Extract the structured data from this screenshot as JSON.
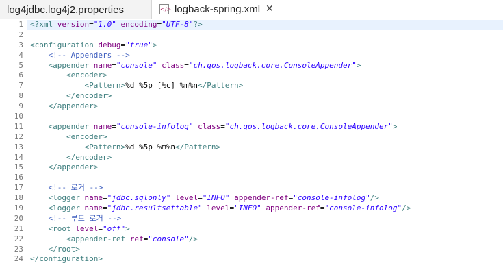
{
  "tabs": [
    {
      "label": "log4jdbc.log4j2.properties",
      "active": false
    },
    {
      "label": "logback-spring.xml",
      "active": true,
      "close": "✕"
    }
  ],
  "colors": {
    "tag": "#3f7f7f",
    "attr": "#7f007f",
    "value": "#2a00ff",
    "comment": "#3f5fbf",
    "text": "#000000",
    "current_line": "#e8f2fe"
  },
  "editor": {
    "lines": [
      {
        "n": "1",
        "tokens": [
          [
            "pi",
            "<?xml "
          ],
          [
            "attr",
            "version"
          ],
          [
            "txt",
            "="
          ],
          [
            "val",
            "\"1.0\""
          ],
          [
            "txt",
            " "
          ],
          [
            "attr",
            "encoding"
          ],
          [
            "txt",
            "="
          ],
          [
            "val",
            "\"UTF-8\""
          ],
          [
            "pi",
            "?>"
          ]
        ]
      },
      {
        "n": "2",
        "tokens": []
      },
      {
        "n": "3",
        "tokens": [
          [
            "tag",
            "<configuration "
          ],
          [
            "attr",
            "debug"
          ],
          [
            "txt",
            "="
          ],
          [
            "val",
            "\"true\""
          ],
          [
            "tag",
            ">"
          ]
        ]
      },
      {
        "n": "4",
        "tokens": [
          [
            "txt",
            "    "
          ],
          [
            "com",
            "<!-- Appenders -->"
          ]
        ]
      },
      {
        "n": "5",
        "tokens": [
          [
            "txt",
            "    "
          ],
          [
            "tag",
            "<appender "
          ],
          [
            "attr",
            "name"
          ],
          [
            "txt",
            "="
          ],
          [
            "val",
            "\"console\""
          ],
          [
            "txt",
            " "
          ],
          [
            "attr",
            "class"
          ],
          [
            "txt",
            "="
          ],
          [
            "val",
            "\"ch.qos.logback.core.ConsoleAppender\""
          ],
          [
            "tag",
            ">"
          ]
        ]
      },
      {
        "n": "6",
        "tokens": [
          [
            "txt",
            "        "
          ],
          [
            "tag",
            "<encoder>"
          ]
        ]
      },
      {
        "n": "7",
        "tokens": [
          [
            "txt",
            "            "
          ],
          [
            "tag",
            "<Pattern>"
          ],
          [
            "txt",
            "%d %5p [%c] %m%n"
          ],
          [
            "tag",
            "</Pattern>"
          ]
        ]
      },
      {
        "n": "8",
        "tokens": [
          [
            "txt",
            "        "
          ],
          [
            "tag",
            "</encoder>"
          ]
        ]
      },
      {
        "n": "9",
        "tokens": [
          [
            "txt",
            "    "
          ],
          [
            "tag",
            "</appender>"
          ]
        ]
      },
      {
        "n": "10",
        "tokens": []
      },
      {
        "n": "11",
        "tokens": [
          [
            "txt",
            "    "
          ],
          [
            "tag",
            "<appender "
          ],
          [
            "attr",
            "name"
          ],
          [
            "txt",
            "="
          ],
          [
            "val",
            "\"console-infolog\""
          ],
          [
            "txt",
            " "
          ],
          [
            "attr",
            "class"
          ],
          [
            "txt",
            "="
          ],
          [
            "val",
            "\"ch.qos.logback.core.ConsoleAppender\""
          ],
          [
            "tag",
            ">"
          ]
        ]
      },
      {
        "n": "12",
        "tokens": [
          [
            "txt",
            "        "
          ],
          [
            "tag",
            "<encoder>"
          ]
        ]
      },
      {
        "n": "13",
        "tokens": [
          [
            "txt",
            "            "
          ],
          [
            "tag",
            "<Pattern>"
          ],
          [
            "txt",
            "%d %5p %m%n"
          ],
          [
            "tag",
            "</Pattern>"
          ]
        ]
      },
      {
        "n": "14",
        "tokens": [
          [
            "txt",
            "        "
          ],
          [
            "tag",
            "</encoder>"
          ]
        ]
      },
      {
        "n": "15",
        "tokens": [
          [
            "txt",
            "    "
          ],
          [
            "tag",
            "</appender>"
          ]
        ]
      },
      {
        "n": "16",
        "tokens": []
      },
      {
        "n": "17",
        "tokens": [
          [
            "txt",
            "    "
          ],
          [
            "com",
            "<!-- 로거 -->"
          ]
        ]
      },
      {
        "n": "18",
        "tokens": [
          [
            "txt",
            "    "
          ],
          [
            "tag",
            "<logger "
          ],
          [
            "attr",
            "name"
          ],
          [
            "txt",
            "="
          ],
          [
            "val",
            "\"jdbc.sqlonly\""
          ],
          [
            "txt",
            " "
          ],
          [
            "attr",
            "level"
          ],
          [
            "txt",
            "="
          ],
          [
            "val",
            "\"INFO\""
          ],
          [
            "txt",
            " "
          ],
          [
            "attr",
            "appender-ref"
          ],
          [
            "txt",
            "="
          ],
          [
            "val",
            "\"console-infolog\""
          ],
          [
            "tag",
            "/>"
          ]
        ]
      },
      {
        "n": "19",
        "tokens": [
          [
            "txt",
            "    "
          ],
          [
            "tag",
            "<logger "
          ],
          [
            "attr",
            "name"
          ],
          [
            "txt",
            "="
          ],
          [
            "val",
            "\"jdbc.resultsettable\""
          ],
          [
            "txt",
            " "
          ],
          [
            "attr",
            "level"
          ],
          [
            "txt",
            "="
          ],
          [
            "val",
            "\"INFO\""
          ],
          [
            "txt",
            " "
          ],
          [
            "attr",
            "appender-ref"
          ],
          [
            "txt",
            "="
          ],
          [
            "val",
            "\"console-infolog\""
          ],
          [
            "tag",
            "/>"
          ]
        ]
      },
      {
        "n": "20",
        "tokens": [
          [
            "txt",
            "    "
          ],
          [
            "com",
            "<!-- 루트 로거 -->"
          ]
        ]
      },
      {
        "n": "21",
        "tokens": [
          [
            "txt",
            "    "
          ],
          [
            "tag",
            "<root "
          ],
          [
            "attr",
            "level"
          ],
          [
            "txt",
            "="
          ],
          [
            "val",
            "\"off\""
          ],
          [
            "tag",
            ">"
          ]
        ]
      },
      {
        "n": "22",
        "tokens": [
          [
            "txt",
            "        "
          ],
          [
            "tag",
            "<appender-ref "
          ],
          [
            "attr",
            "ref"
          ],
          [
            "txt",
            "="
          ],
          [
            "val",
            "\"console\""
          ],
          [
            "tag",
            "/>"
          ]
        ]
      },
      {
        "n": "23",
        "tokens": [
          [
            "txt",
            "    "
          ],
          [
            "tag",
            "</root>"
          ]
        ]
      },
      {
        "n": "24",
        "tokens": [
          [
            "tag",
            "</configuration>"
          ]
        ]
      }
    ]
  }
}
